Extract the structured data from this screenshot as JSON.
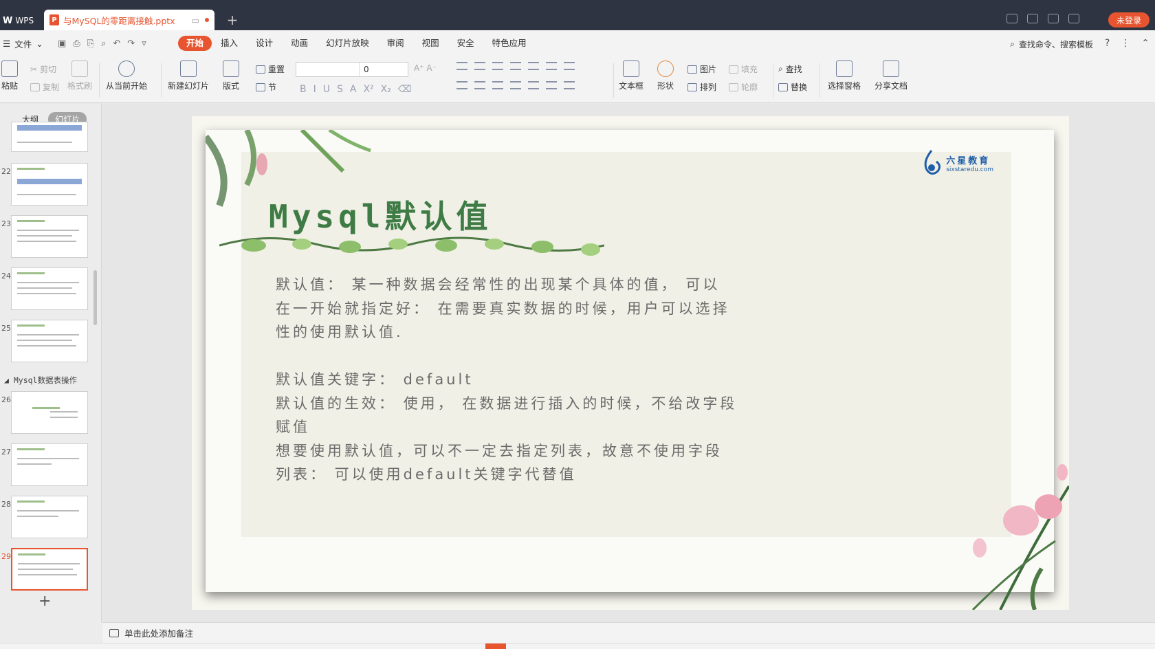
{
  "titlebar": {
    "app_name": "WPS",
    "doc_tab_title": "与MySQL的零距离接触.pptx",
    "login_label": "未登录"
  },
  "menubar": {
    "file_label": "文件",
    "tabs": [
      "开始",
      "插入",
      "设计",
      "动画",
      "幻灯片放映",
      "审阅",
      "视图",
      "安全",
      "特色应用"
    ],
    "search_label": "查找命令、搜索模板",
    "help_label": "?"
  },
  "ribbon": {
    "paste": "粘贴",
    "cut": "剪切",
    "copy": "复制",
    "format_painter": "格式刷",
    "play_from_current": "从当前开始",
    "new_slide": "新建幻灯片",
    "layout": "版式",
    "reset": "重置",
    "section": "节",
    "font_size_value": "0",
    "textbox": "文本框",
    "shape": "形状",
    "picture": "图片",
    "fill": "填充",
    "arrange": "排列",
    "outline": "轮廓",
    "find": "查找",
    "replace": "替换",
    "selection_pane": "选择窗格",
    "share_doc": "分享文档",
    "fmt_buttons": [
      "B",
      "I",
      "U",
      "S",
      "A",
      "X²",
      "X₂"
    ]
  },
  "leftpanel": {
    "tab_outline": "大纲",
    "tab_slides": "幻灯片",
    "section_name": "Mysql数据表操作",
    "slide_numbers": [
      "22",
      "23",
      "24",
      "25",
      "26",
      "27",
      "28",
      "29"
    ],
    "selected_slide": "29",
    "add_icon": "+"
  },
  "slide": {
    "title": "Mysql默认值",
    "logo_cn": "六星教育",
    "logo_en": "sixstaredu.com",
    "lines": [
      "默认值： 某一种数据会经常性的出现某个具体的值， 可以",
      "在一开始就指定好： 在需要真实数据的时候，用户可以选择",
      "性的使用默认值.",
      "",
      "默认值关键字： default",
      "默认值的生效： 使用， 在数据进行插入的时候，不给改字段",
      "赋值",
      "想要使用默认值，可以不一定去指定列表，故意不使用字段",
      "列表： 可以使用default关键字代替值"
    ]
  },
  "notes": {
    "placeholder": "单击此处添加备注"
  },
  "colors": {
    "accent": "#e8542f",
    "title_green": "#3f7b45",
    "titlebar_bg": "#2f3442"
  }
}
